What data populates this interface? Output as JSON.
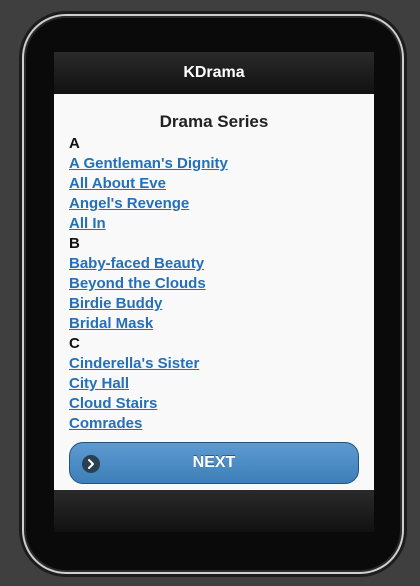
{
  "header": {
    "title": "KDrama"
  },
  "main": {
    "page_title": "Drama Series",
    "groups": [
      {
        "letter": "A",
        "items": [
          "A Gentleman's Dignity",
          "All About Eve",
          "Angel's Revenge",
          "All In"
        ]
      },
      {
        "letter": "B",
        "items": [
          "Baby-faced Beauty",
          "Beyond the Clouds",
          "Birdie Buddy",
          "Bridal Mask"
        ]
      },
      {
        "letter": "C",
        "items": [
          "Cinderella's Sister",
          "City Hall",
          "Cloud Stairs",
          "Comrades"
        ]
      }
    ],
    "next_button": {
      "label": "NEXT",
      "icon": "arrow-right-icon"
    }
  },
  "colors": {
    "link": "#2470b8",
    "button": "#4a8bc4",
    "header": "#1a1a1a"
  }
}
